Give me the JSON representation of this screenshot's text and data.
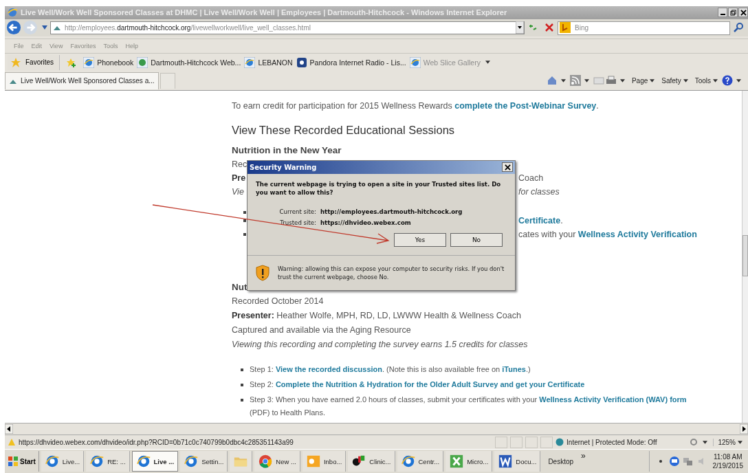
{
  "window": {
    "title": "Live Well/Work Well Sponsored Classes at DHMC | Live Well/Work Well | Employees | Dartmouth-Hitchcock - Windows Internet Explorer"
  },
  "address_bar": {
    "url_prefix": "http://employees.",
    "url_domain": "dartmouth-hitchcock.org",
    "url_path": "/livewellworkwell/live_well_classes.html"
  },
  "search": {
    "placeholder": "Bing"
  },
  "menu": [
    "File",
    "Edit",
    "View",
    "Favorites",
    "Tools",
    "Help"
  ],
  "favorites_bar": {
    "label": "Favorites",
    "links": [
      {
        "label": "Phonebook",
        "kind": "ie",
        "disabled": false
      },
      {
        "label": "Dartmouth-Hitchcock Web...",
        "kind": "globe",
        "disabled": false
      },
      {
        "label": "LEBANON",
        "kind": "ie",
        "disabled": false
      },
      {
        "label": "Pandora Internet Radio - Lis...",
        "kind": "pandora",
        "disabled": false
      },
      {
        "label": "Web Slice Gallery",
        "kind": "ie",
        "disabled": true
      }
    ]
  },
  "tabs": [
    {
      "label": "Live Well/Work Well Sponsored Classes a...",
      "selected": true
    }
  ],
  "command_bar": [
    "Page",
    "Safety",
    "Tools"
  ],
  "page": {
    "intro": [
      {
        "text": "To earn credit for participation for 2015 Wellness Rewards ",
        "link": false
      },
      {
        "text": "complete the Post-Webinar Survey",
        "link": true
      },
      {
        "text": ".",
        "link": false
      }
    ],
    "heading": "View These Recorded Educational Sessions",
    "session_1": {
      "title": "Nutrition in the New Year",
      "lines": [
        {
          "kind": "plain",
          "left": "Rec"
        },
        {
          "kind": "presenter",
          "left": "Pre",
          "right": [
            {
              "text": "Coach",
              "link": false
            }
          ]
        },
        {
          "kind": "italic",
          "left": "Vie",
          "right": [
            {
              "text": "for classes",
              "link": false
            }
          ]
        },
        {
          "kind": "bullet"
        },
        {
          "kind": "bullet",
          "right": [
            {
              "text": "Certificate",
              "link": true
            },
            {
              "text": ".",
              "link": false
            }
          ]
        },
        {
          "kind": "bullet",
          "right": [
            {
              "text": "cates with your ",
              "link": false
            },
            {
              "text": "Wellness Activity Verification",
              "link": true
            }
          ]
        }
      ]
    },
    "session_2": {
      "title": "Nut",
      "recorded": "Recorded October 2014",
      "presenter_label": "Presenter:",
      "presenter": "Heather Wolfe, MPH, RD, LD, LWWW Health & Wellness Coach",
      "availability": "Captured and available via the Aging Resource",
      "credits": "Viewing this recording and completing the survey earns 1.5 credits for classes",
      "steps": [
        [
          {
            "text": "Step 1: ",
            "link": false
          },
          {
            "text": "View the recorded discussion",
            "link": true
          },
          {
            "text": ". (Note this is also available free on ",
            "link": false
          },
          {
            "text": "iTunes",
            "link": true
          },
          {
            "text": ".)",
            "link": false
          }
        ],
        [
          {
            "text": "Step 2: ",
            "link": false
          },
          {
            "text": "Complete the Nutrition & Hydration for the Older Adult Survey and get your Certificate",
            "link": true
          }
        ],
        [
          {
            "text": "Step 3: When you have earned 2.0 hours of classes, submit your certificates with your ",
            "link": false
          },
          {
            "text": "Wellness Activity Verification (WAV) form",
            "link": true
          },
          {
            "text": " (PDF) to Health Plans.",
            "link": false
          }
        ]
      ]
    }
  },
  "dialog": {
    "title": "Security Warning",
    "message": "The current webpage is trying to open a site in your Trusted sites list. Do you want to allow this?",
    "sites": [
      {
        "label": "Current site:",
        "value": "http://employees.dartmouth-hitchcock.org"
      },
      {
        "label": "Trusted site:",
        "value": "https://dhvideo.webex.com"
      }
    ],
    "buttons": [
      "Yes",
      "No"
    ],
    "warning": "Warning: allowing this can expose your computer to security risks. If you don't trust the current webpage, choose No."
  },
  "status_bar": {
    "url": "https://dhvideo.webex.com/dhvideo/idr.php?RCID=0b71c0c740799b0dbc4c285351143a99",
    "zone": "Internet | Protected Mode: Off",
    "zoom": "125%"
  },
  "taskbar": {
    "start": "Start",
    "items": [
      {
        "kind": "ie",
        "label": "Live...",
        "selected": false
      },
      {
        "kind": "ie",
        "label": "RE: ...",
        "selected": false
      },
      {
        "kind": "ie",
        "label": "Live ...",
        "selected": true
      },
      {
        "kind": "ie",
        "label": "Settin...",
        "selected": false
      },
      {
        "kind": "folder",
        "selected": false
      },
      {
        "kind": "chrome",
        "label": "New ...",
        "selected": false
      },
      {
        "kind": "outlook",
        "label": "Inbo...",
        "selected": false
      },
      {
        "kind": "clinic",
        "label": "Clinic...",
        "selected": false
      },
      {
        "kind": "ie",
        "label": "Centr...",
        "selected": false
      },
      {
        "kind": "excel",
        "label": "Micro...",
        "selected": false
      },
      {
        "kind": "word",
        "label": "Docu...",
        "selected": false
      }
    ],
    "toolbar": "Desktop",
    "chevron": "»",
    "time": "11:08 AM",
    "date": "2/19/2015"
  }
}
